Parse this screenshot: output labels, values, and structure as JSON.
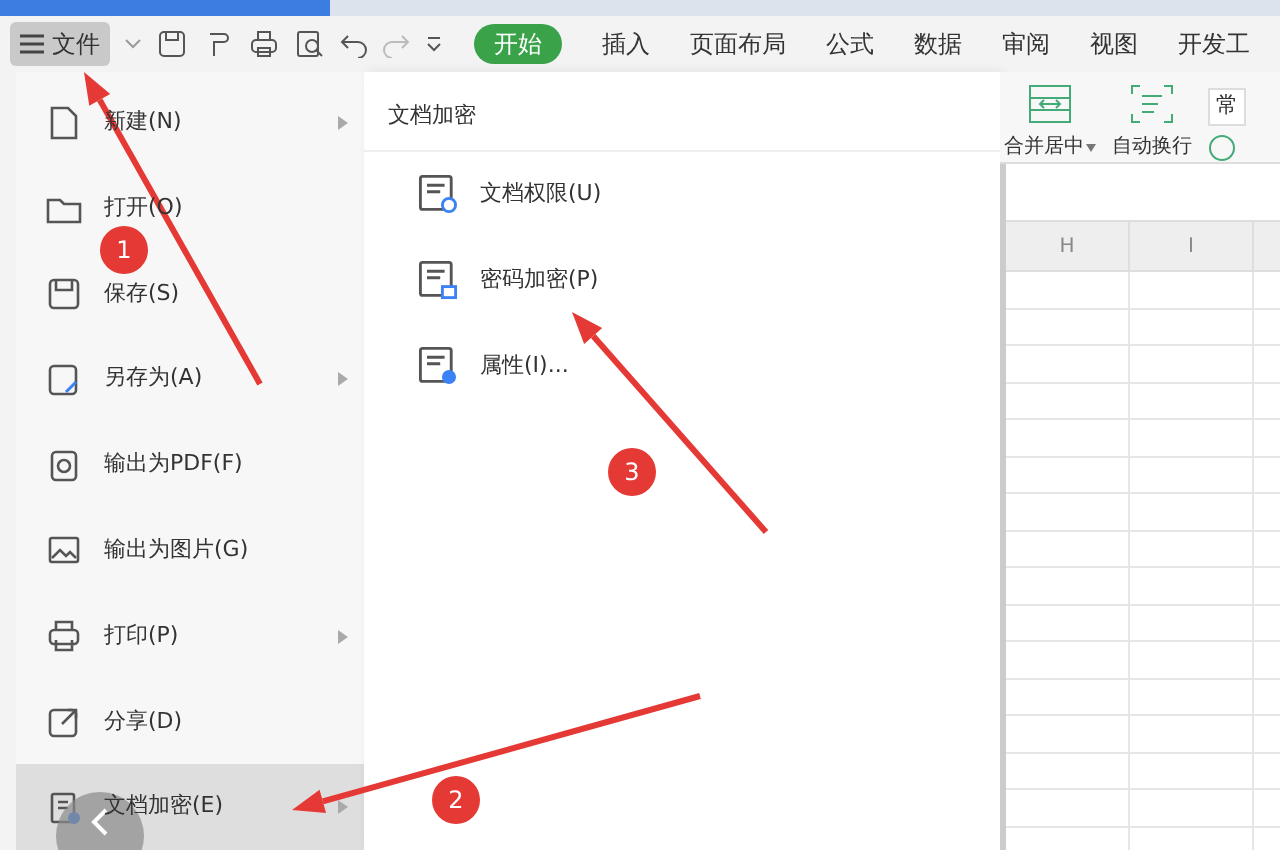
{
  "toolbar": {
    "file_button": "文件",
    "tabs": [
      {
        "label": "开始",
        "selected": true
      },
      {
        "label": "插入",
        "selected": false
      },
      {
        "label": "页面布局",
        "selected": false
      },
      {
        "label": "公式",
        "selected": false
      },
      {
        "label": "数据",
        "selected": false
      },
      {
        "label": "审阅",
        "selected": false
      },
      {
        "label": "视图",
        "selected": false
      },
      {
        "label": "开发工",
        "selected": false
      }
    ]
  },
  "file_menu": {
    "items": [
      {
        "label": "新建(N)",
        "submenu": true,
        "selected": false
      },
      {
        "label": "打开(O)",
        "submenu": false,
        "selected": false
      },
      {
        "label": "保存(S)",
        "submenu": false,
        "selected": false
      },
      {
        "label": "另存为(A)",
        "submenu": true,
        "selected": false
      },
      {
        "label": "输出为PDF(F)",
        "submenu": false,
        "selected": false
      },
      {
        "label": "输出为图片(G)",
        "submenu": false,
        "selected": false
      },
      {
        "label": "打印(P)",
        "submenu": true,
        "selected": false
      },
      {
        "label": "分享(D)",
        "submenu": false,
        "selected": false
      },
      {
        "label": "文档加密(E)",
        "submenu": true,
        "selected": true
      }
    ]
  },
  "submenu": {
    "title": "文档加密",
    "items": [
      {
        "label": "文档权限(U)"
      },
      {
        "label": "密码加密(P)"
      },
      {
        "label": "属性(I)..."
      }
    ]
  },
  "ribbon": {
    "buttons": [
      {
        "label": "合并居中",
        "dropdown": true
      },
      {
        "label": "自动换行",
        "dropdown": false
      }
    ],
    "cut_label": "常"
  },
  "sheet": {
    "columns": [
      "H",
      "I"
    ]
  },
  "annotations": [
    {
      "number": "1"
    },
    {
      "number": "2"
    },
    {
      "number": "3"
    }
  ]
}
